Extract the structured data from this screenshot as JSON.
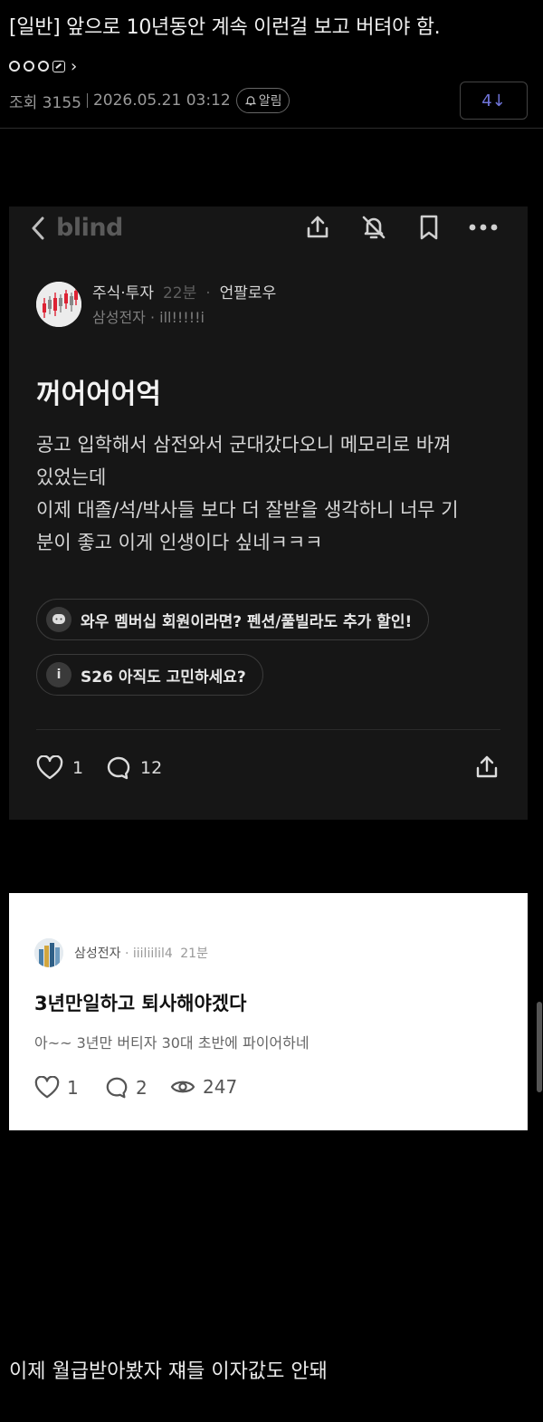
{
  "header": {
    "title": "[일반] 앞으로 10년동안 계속 이런걸 보고 버텨야 함.",
    "views_label": "조회 3155",
    "datetime": "2026.05.21 03:12",
    "alarm_label": "알림",
    "comment_count": "4↓"
  },
  "blind": {
    "logo": "blind",
    "board": "주식·투자",
    "time": "22분",
    "nickname": "언팔로우",
    "company": "삼성전자 · ill!!!!!i",
    "title": "꺼어어어억",
    "body": [
      "공고 입학해서 삼전와서 군대갔다오니 메모리로 바껴",
      "있었는데",
      "이제 대졸/석/박사들 보다 더 잘받을 생각하니 너무 기",
      "분이 좋고 이게 인생이다 싶네ㅋㅋㅋ"
    ],
    "pills": [
      "와우 멤버십 회원이라면? 펜션/풀빌라도 추가 할인!",
      "S26 아직도 고민하세요?"
    ],
    "likes": "1",
    "comments": "12"
  },
  "reply_card": {
    "company": "삼성전자",
    "nickname": "· iiiliilil4",
    "time": "21분",
    "title": "3년만일하고 퇴사해야겠다",
    "body": "아~~ 3년만 버티자 30대 초반에 파이어하네",
    "likes": "1",
    "comments": "2",
    "views": "247"
  },
  "caption": "이제 월급받아봤자 쟤들 이자값도 안돼"
}
